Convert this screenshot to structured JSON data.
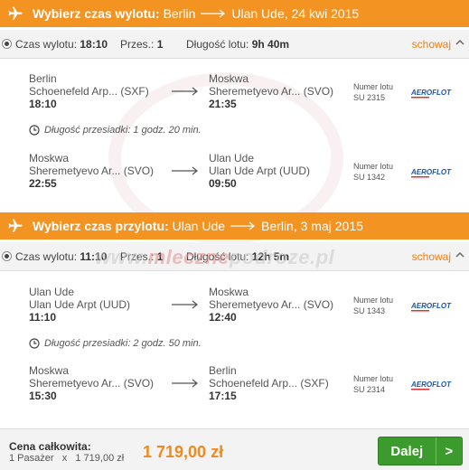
{
  "outbound": {
    "header": {
      "title": "Wybierz czas wylotu:",
      "from": "Berlin",
      "to": "Ulan Ude, 24 kwi 2015"
    },
    "summary": {
      "departure_label": "Czas wylotu:",
      "departure_time": "18:10",
      "stops_label": "Przes.:",
      "stops": "1",
      "duration_label": "Długość lotu:",
      "duration": "9h 40m",
      "hide_label": "schowaj"
    },
    "segments": [
      {
        "from_city": "Berlin",
        "from_airport": "Schoenefeld Arp... (SXF)",
        "from_time": "18:10",
        "to_city": "Moskwa",
        "to_airport": "Sheremetyevo Ar... (SVO)",
        "to_time": "21:35",
        "flight_label": "Numer lotu",
        "flight_no": "SU 2315"
      },
      {
        "from_city": "Moskwa",
        "from_airport": "Sheremetyevo Ar... (SVO)",
        "from_time": "22:55",
        "to_city": "Ulan Ude",
        "to_airport": "Ulan Ude Arpt (UUD)",
        "to_time": "09:50",
        "flight_label": "Numer lotu",
        "flight_no": "SU 1342"
      }
    ],
    "layover": "Długość przesiadki: 1 godz. 20 min."
  },
  "inbound": {
    "header": {
      "title": "Wybierz czas przylotu:",
      "from": "Ulan Ude",
      "to": "Berlin, 3 maj 2015"
    },
    "summary": {
      "departure_label": "Czas wylotu:",
      "departure_time": "11:10",
      "stops_label": "Przes.:",
      "stops": "1",
      "duration_label": "Długość lotu:",
      "duration": "12h 5m",
      "hide_label": "schowaj"
    },
    "segments": [
      {
        "from_city": "Ulan Ude",
        "from_airport": "Ulan Ude Arpt (UUD)",
        "from_time": "11:10",
        "to_city": "Moskwa",
        "to_airport": "Sheremetyevo Ar... (SVO)",
        "to_time": "12:40",
        "flight_label": "Numer lotu",
        "flight_no": "SU 1343"
      },
      {
        "from_city": "Moskwa",
        "from_airport": "Sheremetyevo Ar... (SVO)",
        "from_time": "15:30",
        "to_city": "Berlin",
        "to_airport": "Schoenefeld Arp... (SXF)",
        "to_time": "17:15",
        "flight_label": "Numer lotu",
        "flight_no": "SU 2314"
      }
    ],
    "layover": "Długość przesiadki: 2 godz. 50 min."
  },
  "airline": "AEROFLOT",
  "watermark": {
    "part1": "www.",
    "part2": "mleczne",
    "part3": "podroze",
    "part4": ".pl"
  },
  "footer": {
    "total_label": "Cena całkowita:",
    "passengers": "1 Pasażer",
    "times": "x",
    "unit_price": "1 719,00 zł",
    "total": "1 719,00 zł",
    "next_label": "Dalej",
    "next_arrow": ">"
  },
  "colors": {
    "accent": "#f39321",
    "price": "#f08a1c",
    "button": "#3b9b2c",
    "airline": "#1a56a8"
  }
}
